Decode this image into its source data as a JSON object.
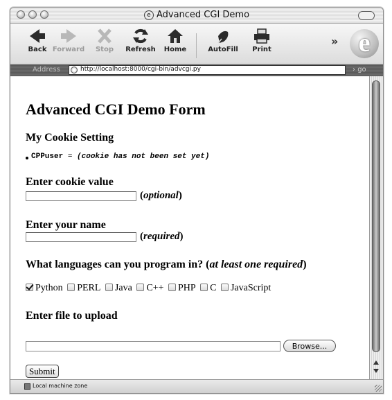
{
  "window": {
    "title": "Advanced CGI Demo"
  },
  "toolbar": {
    "back_label": "Back",
    "forward_label": "Forward",
    "stop_label": "Stop",
    "refresh_label": "Refresh",
    "home_label": "Home",
    "autofill_label": "AutoFill",
    "print_label": "Print",
    "overflow_label": "»",
    "icons": {
      "back": "back-arrow-icon",
      "forward": "forward-arrow-icon",
      "stop": "stop-x-icon",
      "refresh": "refresh-icon",
      "home": "home-icon",
      "autofill": "autofill-pen-icon",
      "print": "printer-icon",
      "browser_logo": "ie-logo-icon"
    }
  },
  "address_bar": {
    "label": "Address",
    "url": "http://localhost:8000/cgi-bin/advcgi.py",
    "go_label": "go"
  },
  "page": {
    "heading": "Advanced CGI Demo Form",
    "cookie_section": {
      "heading": "My Cookie Setting",
      "cookie_key": "CPPuser",
      "cookie_separator": " = ",
      "cookie_value": "(cookie has not been set yet)"
    },
    "cookie_field": {
      "label": "Enter cookie value",
      "value": "",
      "note_open": "(",
      "note_word": "optional",
      "note_close": ")"
    },
    "name_field": {
      "label": "Enter your name",
      "value": "",
      "note_open": "(",
      "note_word": "required",
      "note_close": ")"
    },
    "languages": {
      "question": "What languages can you program in? (",
      "question_note": "at least one required",
      "question_close": ")",
      "options": [
        {
          "label": "Python",
          "checked": true
        },
        {
          "label": "PERL",
          "checked": false
        },
        {
          "label": "Java",
          "checked": false
        },
        {
          "label": "C++",
          "checked": false
        },
        {
          "label": "PHP",
          "checked": false
        },
        {
          "label": "C",
          "checked": false
        },
        {
          "label": "JavaScript",
          "checked": false
        }
      ]
    },
    "upload": {
      "label": "Enter file to upload",
      "value": "",
      "browse_label": "Browse..."
    },
    "submit_label": "Submit"
  },
  "status_bar": {
    "zone_label": "Local machine zone"
  }
}
